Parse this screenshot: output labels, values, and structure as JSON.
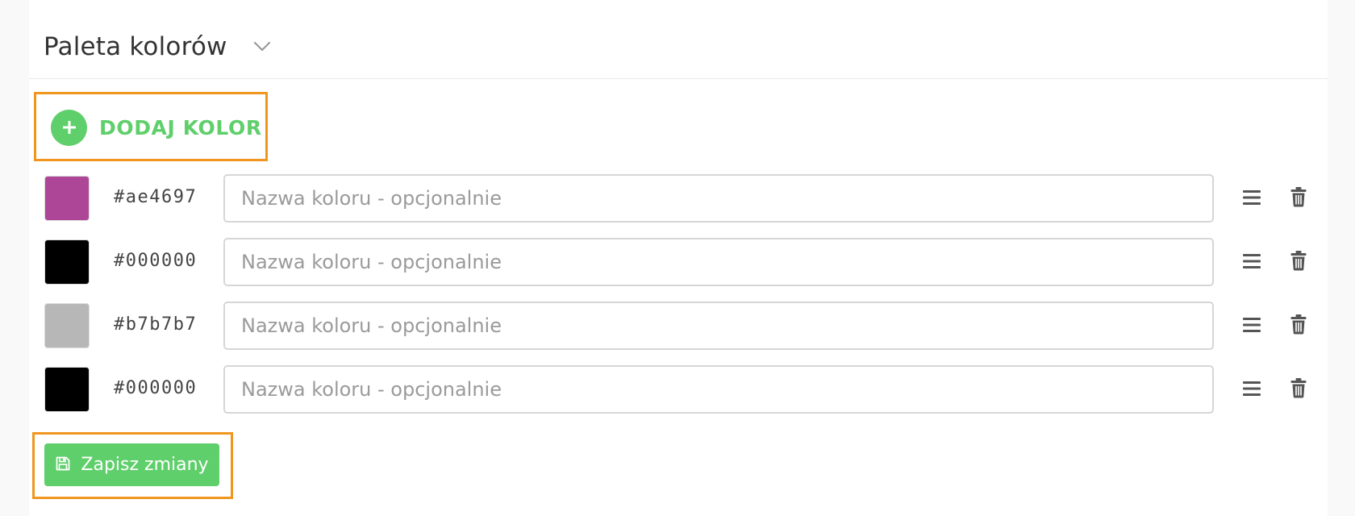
{
  "header": {
    "title": "Paleta kolorów",
    "toggle_icon": "chevron-down-icon"
  },
  "add_button": {
    "label": "DODAJ KOLOR",
    "icon": "plus-circle-icon",
    "color": "#5fcf6b"
  },
  "colors": [
    {
      "hex": "#ae4697",
      "swatch": "#ae4697",
      "name_value": "",
      "name_placeholder": "Nazwa koloru - opcjonalnie"
    },
    {
      "hex": "#000000",
      "swatch": "#000000",
      "name_value": "",
      "name_placeholder": "Nazwa koloru - opcjonalnie"
    },
    {
      "hex": "#b7b7b7",
      "swatch": "#b7b7b7",
      "name_value": "",
      "name_placeholder": "Nazwa koloru - opcjonalnie"
    },
    {
      "hex": "#000000",
      "swatch": "#000000",
      "name_value": "",
      "name_placeholder": "Nazwa koloru - opcjonalnie"
    }
  ],
  "row_icons": {
    "drag": "drag-handle-icon",
    "delete": "trash-icon"
  },
  "save_button": {
    "label": "Zapisz zmiany",
    "icon": "floppy-disk-icon",
    "color": "#5fcf6b"
  },
  "highlight_color": "#f0961e"
}
